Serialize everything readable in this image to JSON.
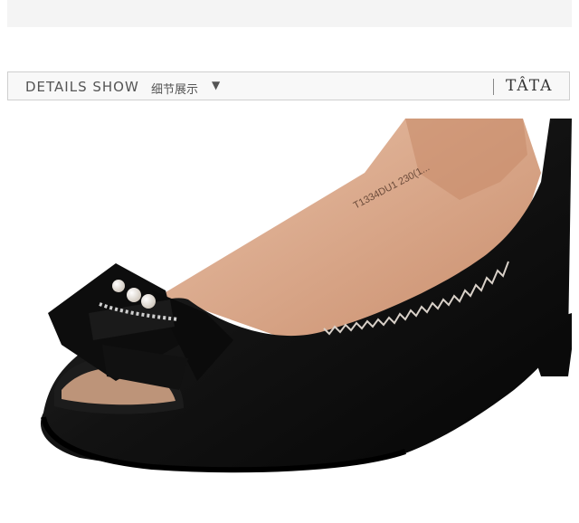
{
  "details": {
    "title": "DETAILS SHOW",
    "subtitle": "细节展示",
    "caret": "▼"
  },
  "brand": {
    "name": "TÂTA"
  },
  "product": {
    "insole_print": "T1334DU1  230(1..."
  },
  "colors": {
    "shoe": "#141414",
    "lining": "#d9a98a",
    "bar_bg": "#f8f8f8",
    "bar_border": "#cfcfcf"
  }
}
